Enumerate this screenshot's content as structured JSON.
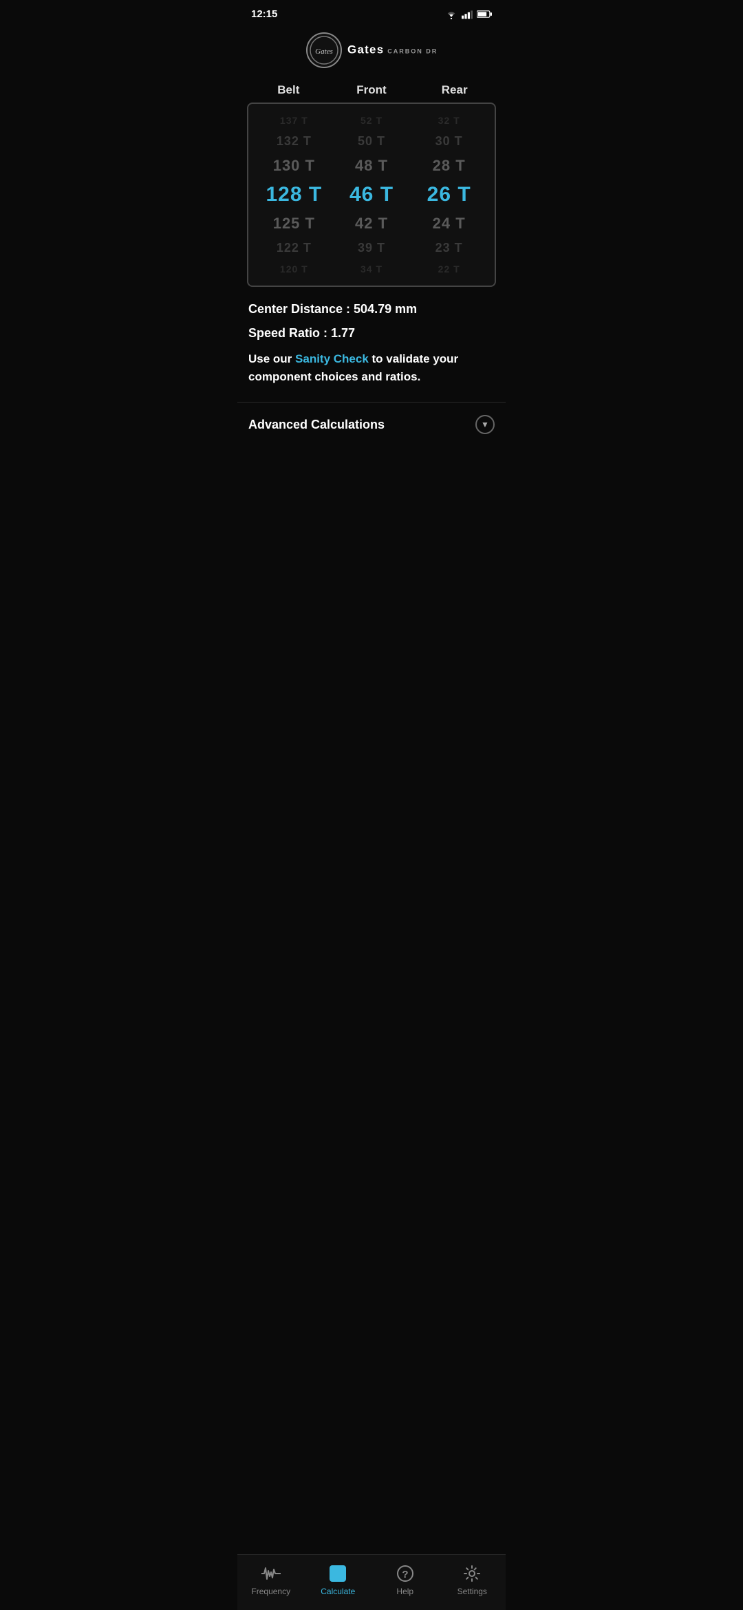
{
  "statusBar": {
    "time": "12:15"
  },
  "logo": {
    "circleText": "Gates",
    "brand": "Gates",
    "tagline": "CARBON DRIVE™"
  },
  "columns": {
    "belt": "Belt",
    "front": "Front",
    "rear": "Rear"
  },
  "pickerRows": [
    {
      "belt": "137 T",
      "front": "52 T",
      "rear": "32 T",
      "style": "faded2"
    },
    {
      "belt": "132 T",
      "front": "50 T",
      "rear": "30 T",
      "style": "faded"
    },
    {
      "belt": "130 T",
      "front": "48 T",
      "rear": "28 T",
      "style": "normal"
    },
    {
      "belt": "128 T",
      "front": "46 T",
      "rear": "26 T",
      "style": "selected"
    },
    {
      "belt": "125 T",
      "front": "42 T",
      "rear": "24 T",
      "style": "normal"
    },
    {
      "belt": "122 T",
      "front": "39 T",
      "rear": "23 T",
      "style": "faded"
    },
    {
      "belt": "120 T",
      "front": "34 T",
      "rear": "22 T",
      "style": "faded2"
    }
  ],
  "results": {
    "centerDistance": "Center Distance : 504.79 mm",
    "speedRatio": "Speed Ratio : 1.77",
    "sanityPre": "Use our ",
    "sanityLink": "Sanity Check",
    "sanityPost": " to validate your component choices and ratios."
  },
  "advanced": {
    "label": "Advanced Calculations"
  },
  "bottomNav": {
    "items": [
      {
        "id": "frequency",
        "label": "Frequency",
        "active": false
      },
      {
        "id": "calculate",
        "label": "Calculate",
        "active": true
      },
      {
        "id": "help",
        "label": "Help",
        "active": false
      },
      {
        "id": "settings",
        "label": "Settings",
        "active": false
      }
    ]
  }
}
